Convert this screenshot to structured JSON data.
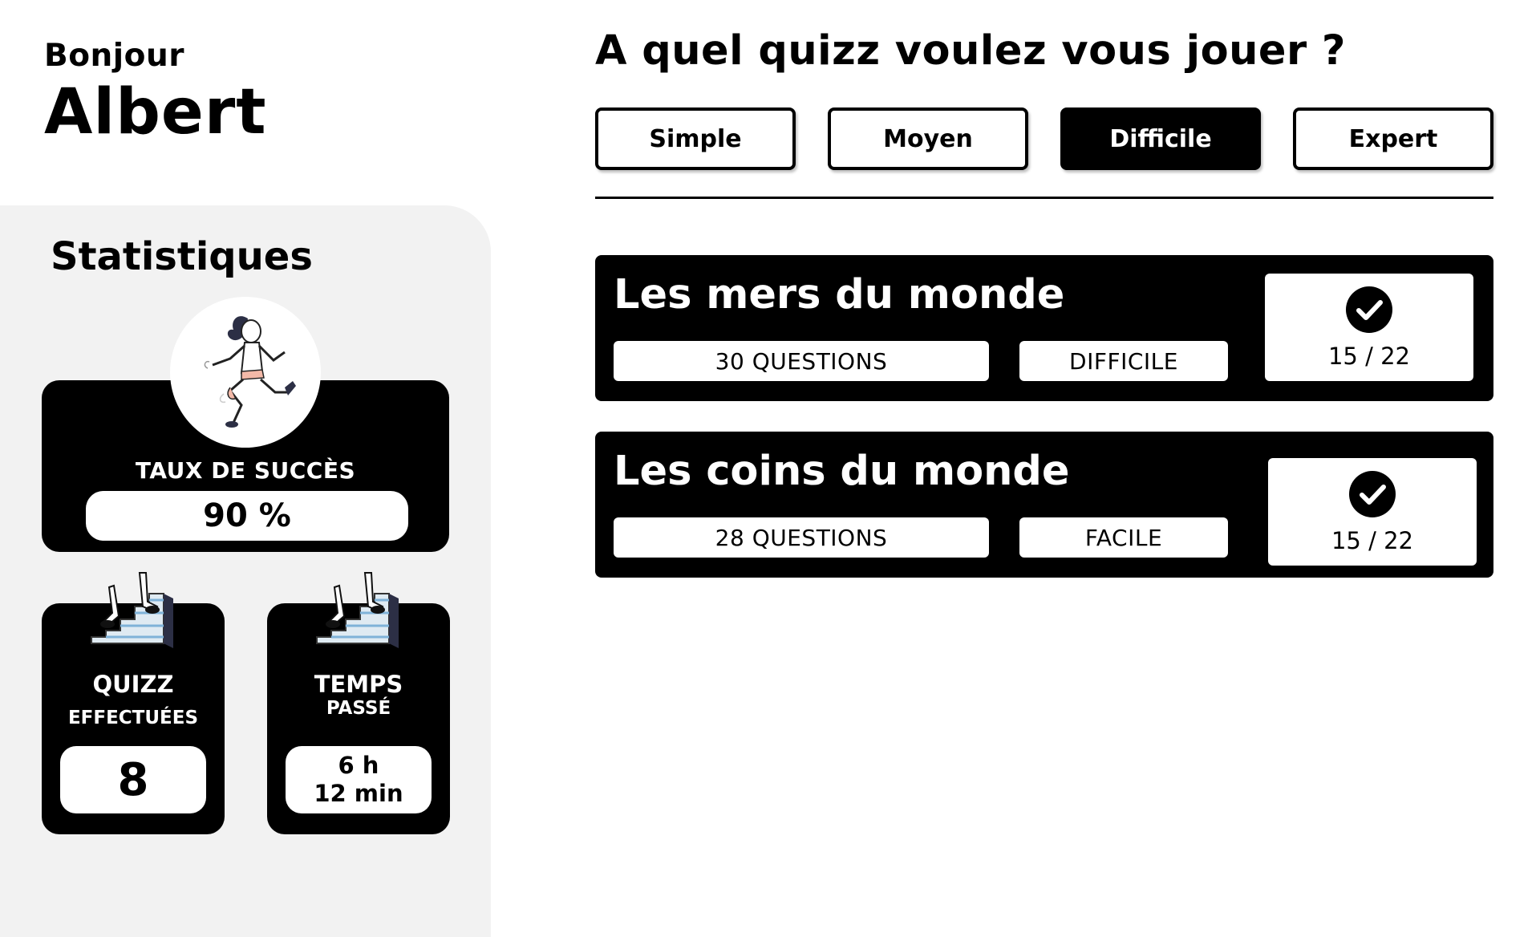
{
  "greeting": {
    "hello": "Bonjour",
    "name": "Albert"
  },
  "stats": {
    "title": "Statistiques",
    "success": {
      "label": "TAUX DE SUCCÈS",
      "value": "90 %",
      "illustration": "runner-illustration"
    },
    "quizz": {
      "label1": "QUIZZ",
      "label2": "EFFECTUÉES",
      "value": "8",
      "illustration": "stairs-illustration"
    },
    "time": {
      "label1": "TEMPS",
      "label2": "PASSÉ",
      "value_line1": "6 h",
      "value_line2": "12 min",
      "illustration": "stairs-illustration"
    }
  },
  "main": {
    "question": "A quel quizz voulez vous jouer ?",
    "levels": [
      {
        "label": "Simple",
        "active": false
      },
      {
        "label": "Moyen",
        "active": false
      },
      {
        "label": "Difficile",
        "active": true
      },
      {
        "label": "Expert",
        "active": false
      }
    ],
    "quizzes": [
      {
        "title": "Les mers du monde",
        "questions": "30 QUESTIONS",
        "level": "DIFFICILE",
        "score": "15 / 22",
        "status_icon": "check-circle-icon"
      },
      {
        "title": "Les coins du monde",
        "questions": "28 QUESTIONS",
        "level": "FACILE",
        "score": "15 / 22",
        "status_icon": "check-circle-icon"
      }
    ]
  },
  "colors": {
    "background": "#ffffff",
    "panel": "#f2f2f2",
    "card": "#000000",
    "accent_text": "#ffffff"
  }
}
